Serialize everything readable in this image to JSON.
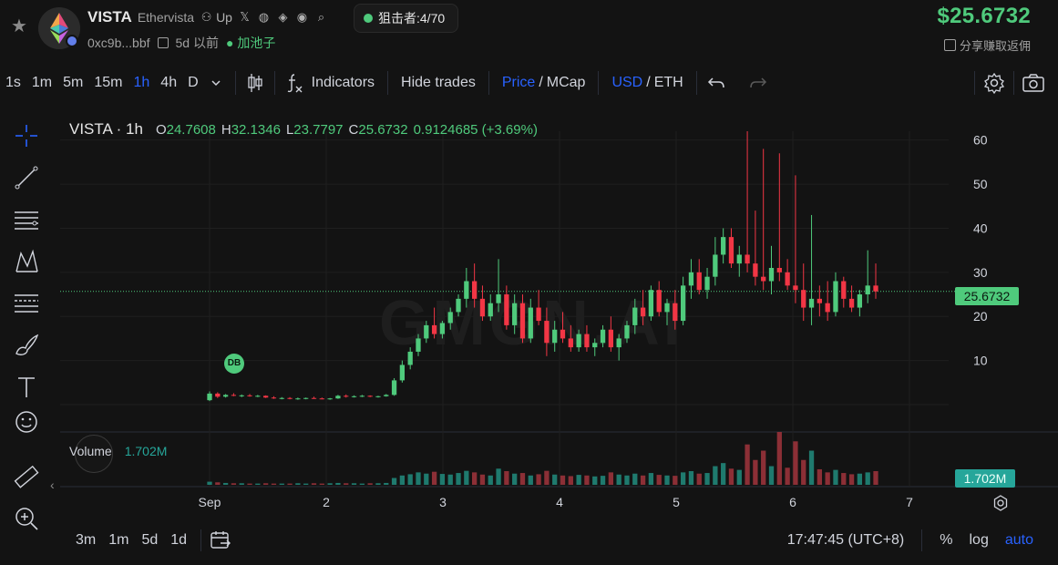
{
  "header": {
    "symbol": "VISTA",
    "name": "Ethervista",
    "up_label": "Up",
    "address": "0xc9b...bbf",
    "age": "5d 以前",
    "pool_label": "加池子",
    "sniper_label": "狙击者:4/70",
    "price": "$25.6732",
    "share_label": "分享赚取返佣"
  },
  "toolbar": {
    "intervals": [
      "1s",
      "1m",
      "5m",
      "15m",
      "1h",
      "4h",
      "D"
    ],
    "active_interval": "1h",
    "indicators_label": "Indicators",
    "hide_trades_label": "Hide trades",
    "price_label": "Price",
    "mcap_label": "MCap",
    "usd_label": "USD",
    "eth_label": "ETH"
  },
  "legend": {
    "symbol": "VISTA · 1h",
    "o_key": "O",
    "o_val": "24.7608",
    "h_key": "H",
    "h_val": "32.1346",
    "l_key": "L",
    "l_val": "23.7797",
    "c_key": "C",
    "c_val": "25.6732",
    "change": "0.9124685 (+3.69%)"
  },
  "volume": {
    "label": "Volume",
    "value": "1.702M",
    "tag": "1.702M"
  },
  "price_tag": "25.6732",
  "db_badge": "DB",
  "watermark": "GMGN.AI",
  "bottom": {
    "ranges": [
      "3m",
      "1m",
      "5d",
      "1d"
    ],
    "time": "17:47:45 (UTC+8)",
    "percent": "%",
    "log": "log",
    "auto": "auto"
  },
  "colors": {
    "up": "#4fca7c",
    "down": "#f23645",
    "accent": "#2962ff"
  },
  "chart_data": {
    "type": "candlestick",
    "y_ticks": [
      10,
      20,
      30,
      40,
      50,
      60
    ],
    "x_ticks": [
      "Sep",
      "2",
      "3",
      "4",
      "5",
      "6",
      "7"
    ],
    "ylim": [
      0,
      62
    ],
    "last_price": 25.6732,
    "candles": [
      [
        1.0,
        3.0,
        0.8,
        2.5
      ],
      [
        2.5,
        2.8,
        1.5,
        1.8
      ],
      [
        1.8,
        2.4,
        1.6,
        2.2
      ],
      [
        2.2,
        2.6,
        1.9,
        2.0
      ],
      [
        2.0,
        2.3,
        1.7,
        2.1
      ],
      [
        2.1,
        2.4,
        1.8,
        1.9
      ],
      [
        1.9,
        2.2,
        1.7,
        2.0
      ],
      [
        2.0,
        2.1,
        1.5,
        1.6
      ],
      [
        1.6,
        1.9,
        1.3,
        1.4
      ],
      [
        1.4,
        1.7,
        1.2,
        1.5
      ],
      [
        1.5,
        1.7,
        1.2,
        1.3
      ],
      [
        1.3,
        1.6,
        1.1,
        1.4
      ],
      [
        1.4,
        1.6,
        1.2,
        1.5
      ],
      [
        1.5,
        1.8,
        1.3,
        1.4
      ],
      [
        1.4,
        1.6,
        1.2,
        1.3
      ],
      [
        1.3,
        1.5,
        1.1,
        1.4
      ],
      [
        1.4,
        2.2,
        1.3,
        2.0
      ],
      [
        2.0,
        2.3,
        1.6,
        1.8
      ],
      [
        1.8,
        2.1,
        1.6,
        1.9
      ],
      [
        1.9,
        2.2,
        1.7,
        2.0
      ],
      [
        2.0,
        2.1,
        1.7,
        1.8
      ],
      [
        1.8,
        2.0,
        1.6,
        1.9
      ],
      [
        1.9,
        2.4,
        1.8,
        2.2
      ],
      [
        2.2,
        6.0,
        2.0,
        5.5
      ],
      [
        5.5,
        10.0,
        5.0,
        9.0
      ],
      [
        9.0,
        13.0,
        8.0,
        12.0
      ],
      [
        12.0,
        16.0,
        11.0,
        15.0
      ],
      [
        15.0,
        19.0,
        14.0,
        18.0
      ],
      [
        18.0,
        22.0,
        15.0,
        16.0
      ],
      [
        16.0,
        19.0,
        15.0,
        18.5
      ],
      [
        18.5,
        22.0,
        17.0,
        21.0
      ],
      [
        21.0,
        25.0,
        20.0,
        24.0
      ],
      [
        24.0,
        31.0,
        22.0,
        28.0
      ],
      [
        28.0,
        32.0,
        22.0,
        24.0
      ],
      [
        24.0,
        27.0,
        19.0,
        20.0
      ],
      [
        20.0,
        25.0,
        19.0,
        23.0
      ],
      [
        23.0,
        33.0,
        21.0,
        25.0
      ],
      [
        25.0,
        27.0,
        17.0,
        18.0
      ],
      [
        18.0,
        25.0,
        16.0,
        23.0
      ],
      [
        23.0,
        25.0,
        14.0,
        15.0
      ],
      [
        15.0,
        24.0,
        14.0,
        22.0
      ],
      [
        22.0,
        26.0,
        18.0,
        19.0
      ],
      [
        19.0,
        22.0,
        11.0,
        14.0
      ],
      [
        14.0,
        19.0,
        12.0,
        17.0
      ],
      [
        17.0,
        21.0,
        14.0,
        15.0
      ],
      [
        15.0,
        18.0,
        12.0,
        13.0
      ],
      [
        13.0,
        17.0,
        12.0,
        16.0
      ],
      [
        16.0,
        18.0,
        12.0,
        13.0
      ],
      [
        13.0,
        15.0,
        11.0,
        14.0
      ],
      [
        14.0,
        18.0,
        13.0,
        17.0
      ],
      [
        17.0,
        20.0,
        12.0,
        13.0
      ],
      [
        13.0,
        16.0,
        10.0,
        15.0
      ],
      [
        15.0,
        19.0,
        14.0,
        18.0
      ],
      [
        18.0,
        24.0,
        16.0,
        22.0
      ],
      [
        22.0,
        26.0,
        18.0,
        20.0
      ],
      [
        20.0,
        27.0,
        19.0,
        26.0
      ],
      [
        26.0,
        28.0,
        20.0,
        21.0
      ],
      [
        21.0,
        24.0,
        18.0,
        23.0
      ],
      [
        23.0,
        26.0,
        17.0,
        19.0
      ],
      [
        19.0,
        29.0,
        18.0,
        27.0
      ],
      [
        27.0,
        33.0,
        24.0,
        30.0
      ],
      [
        30.0,
        33.0,
        25.0,
        26.0
      ],
      [
        26.0,
        31.0,
        24.0,
        29.0
      ],
      [
        29.0,
        38.0,
        27.0,
        34.0
      ],
      [
        34.0,
        40.0,
        32.0,
        38.0
      ],
      [
        38.0,
        40.0,
        31.0,
        32.0
      ],
      [
        32.0,
        36.0,
        29.0,
        34.0
      ],
      [
        34.0,
        62.0,
        30.0,
        32.0
      ],
      [
        32.0,
        44.0,
        27.0,
        29.0
      ],
      [
        29.0,
        58.0,
        26.0,
        28.0
      ],
      [
        28.0,
        36.0,
        25.0,
        31.0
      ],
      [
        31.0,
        57.0,
        28.0,
        30.0
      ],
      [
        30.0,
        33.0,
        26.0,
        27.0
      ],
      [
        27.0,
        52.0,
        23.0,
        26.0
      ],
      [
        26.0,
        32.0,
        19.0,
        22.0
      ],
      [
        22.0,
        43.0,
        18.0,
        24.0
      ],
      [
        24.0,
        27.0,
        20.0,
        23.0
      ],
      [
        23.0,
        28.0,
        19.0,
        21.0
      ],
      [
        21.0,
        30.0,
        20.0,
        28.0
      ],
      [
        28.0,
        29.0,
        22.0,
        24.0
      ],
      [
        24.0,
        27.0,
        21.0,
        22.0
      ],
      [
        22.0,
        26.0,
        20.0,
        25.0
      ],
      [
        25.0,
        35.0,
        23.0,
        27.0
      ],
      [
        27.0,
        32.0,
        24.0,
        25.6732
      ]
    ],
    "volumes": [
      0.1,
      0.08,
      0.06,
      0.05,
      0.05,
      0.04,
      0.04,
      0.05,
      0.04,
      0.04,
      0.04,
      0.05,
      0.04,
      0.05,
      0.04,
      0.05,
      0.06,
      0.05,
      0.05,
      0.04,
      0.05,
      0.05,
      0.06,
      0.22,
      0.3,
      0.34,
      0.4,
      0.36,
      0.42,
      0.35,
      0.33,
      0.38,
      0.45,
      0.4,
      0.33,
      0.3,
      0.52,
      0.44,
      0.36,
      0.38,
      0.3,
      0.34,
      0.45,
      0.33,
      0.3,
      0.28,
      0.32,
      0.3,
      0.27,
      0.29,
      0.4,
      0.33,
      0.3,
      0.36,
      0.3,
      0.38,
      0.32,
      0.3,
      0.29,
      0.4,
      0.44,
      0.36,
      0.38,
      0.6,
      0.7,
      0.52,
      0.48,
      1.3,
      0.8,
      1.1,
      0.6,
      1.702,
      0.55,
      1.4,
      0.8,
      1.1,
      0.5,
      0.4,
      0.48,
      0.38,
      0.34,
      0.36,
      0.4,
      0.44
    ]
  }
}
